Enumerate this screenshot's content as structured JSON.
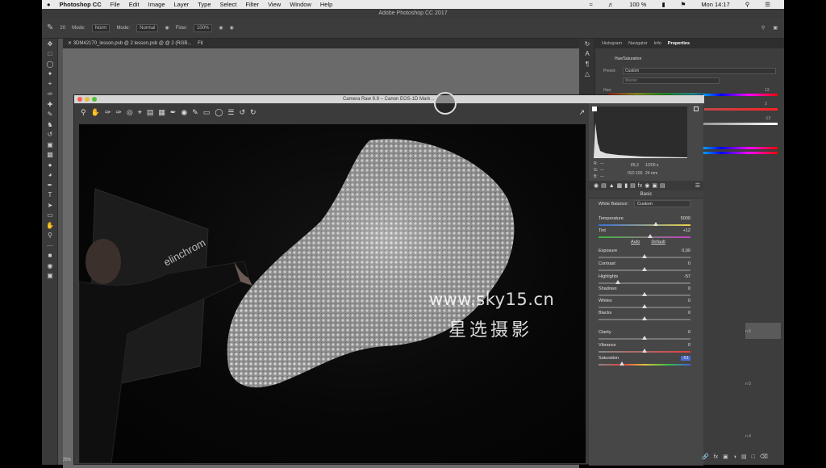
{
  "menubar": {
    "apple": "",
    "app": "Photoshop CC",
    "items": [
      "File",
      "Edit",
      "Image",
      "Layer",
      "Type",
      "Select",
      "Filter",
      "View",
      "Window",
      "Help"
    ],
    "battery": "100 %",
    "time": "Mon 14:17"
  },
  "ps": {
    "title": "Adobe Photoshop CC 2017",
    "options": {
      "mode_label": "Mode:",
      "mode_value": "Norm",
      "mode2_label": "Mode:",
      "mode2_value": "Normal",
      "flow_label": "Flow:",
      "flow_value": "100%",
      "brush_size": "20"
    },
    "doc_tab": "3DM42170_lesson.psb @ 2 lesson.psb @ @ 2 (RGB...",
    "doc_tab2": "Fit",
    "zoom": "25%",
    "panel_tabs": [
      "Histogram",
      "Navigator",
      "Info",
      "Properties"
    ],
    "properties": {
      "title": "Hue/Saturation",
      "preset_label": "Preset:",
      "preset_value": "Custom",
      "channel": "Master",
      "hue_label": "Hue:",
      "hue_value": "13",
      "sat_value": "3",
      "light_value": "-13"
    },
    "layer_labels": [
      "n 6",
      "n 5",
      "n 4"
    ]
  },
  "camera_raw": {
    "title": "Camera Raw 9.9  –  Canon EOS-1D Mark ...",
    "info": {
      "r_label": "R:",
      "g_label": "G:",
      "b_label": "B:",
      "r": "---",
      "g": "---",
      "b": "---",
      "aperture": "f/6,3",
      "shutter": "1/200 s",
      "iso": "ISO 100",
      "focal": "24 mm"
    },
    "panel_title": "Basic",
    "white_balance_label": "White Balance:",
    "white_balance_value": "Custom",
    "auto": "Auto",
    "default": "Default",
    "sliders": [
      {
        "label": "Temperature",
        "value": "5000",
        "pos": 0.62
      },
      {
        "label": "Tint",
        "value": "+12",
        "pos": 0.56
      },
      {
        "label": "Exposure",
        "value": "0,00",
        "pos": 0.5
      },
      {
        "label": "Contrast",
        "value": "0",
        "pos": 0.5
      },
      {
        "label": "Highlights",
        "value": "-57",
        "pos": 0.21
      },
      {
        "label": "Shadows",
        "value": "0",
        "pos": 0.5
      },
      {
        "label": "Whites",
        "value": "0",
        "pos": 0.5
      },
      {
        "label": "Blacks",
        "value": "0",
        "pos": 0.5
      },
      {
        "label": "Clarity",
        "value": "0",
        "pos": 0.5
      },
      {
        "label": "Vibrance",
        "value": "0",
        "pos": 0.5
      },
      {
        "label": "Saturation",
        "value": "-51",
        "pos": 0.25
      }
    ],
    "photo_brand": "elinchrom"
  },
  "watermark": {
    "url": "www.sky15.cn",
    "cn": "星选摄影"
  }
}
